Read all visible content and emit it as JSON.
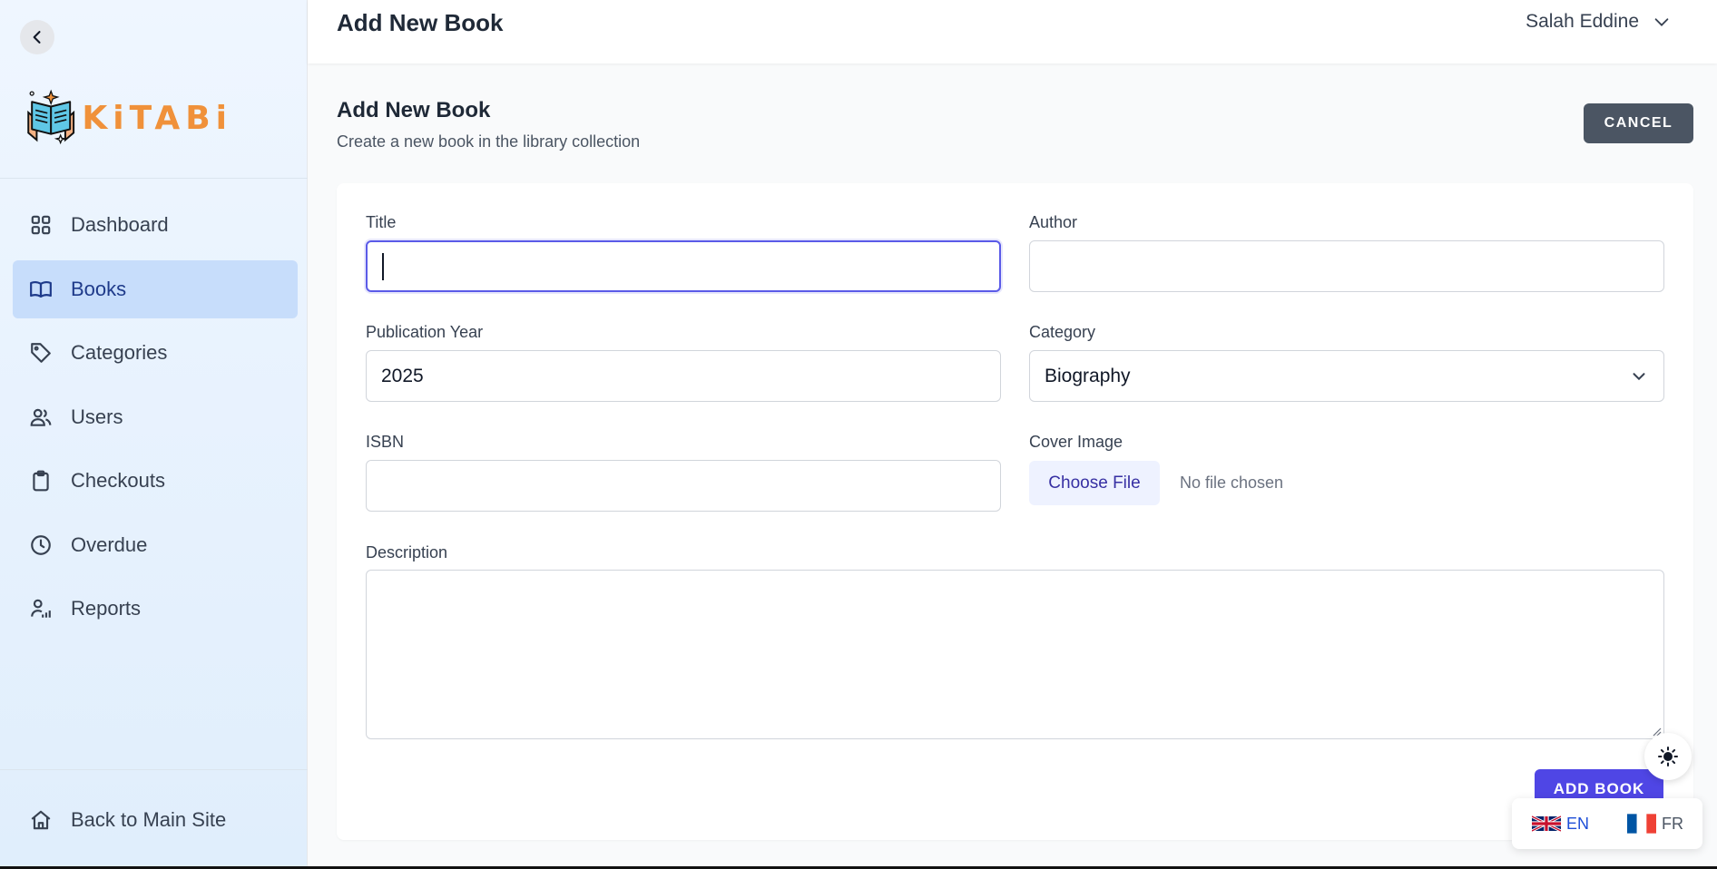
{
  "sidebar": {
    "logo_text": "KiTABi",
    "items": [
      {
        "label": "Dashboard",
        "icon": "grid-icon"
      },
      {
        "label": "Books",
        "icon": "book-open-icon",
        "active": true
      },
      {
        "label": "Categories",
        "icon": "tag-icon"
      },
      {
        "label": "Users",
        "icon": "users-icon"
      },
      {
        "label": "Checkouts",
        "icon": "clipboard-icon"
      },
      {
        "label": "Overdue",
        "icon": "clock-icon"
      },
      {
        "label": "Reports",
        "icon": "user-chart-icon"
      }
    ],
    "back_to_main": "Back to Main Site"
  },
  "header": {
    "title": "Add New Book",
    "user_name": "Salah Eddine"
  },
  "page": {
    "heading": "Add New Book",
    "subheading": "Create a new book in the library collection",
    "cancel_label": "CANCEL"
  },
  "form": {
    "title_label": "Title",
    "title_value": "",
    "author_label": "Author",
    "author_value": "",
    "year_label": "Publication Year",
    "year_value": "2025",
    "category_label": "Category",
    "category_value": "Biography",
    "isbn_label": "ISBN",
    "isbn_value": "",
    "cover_label": "Cover Image",
    "choose_file_label": "Choose File",
    "file_status": "No file chosen",
    "description_label": "Description",
    "description_value": "",
    "submit_label": "ADD BOOK"
  },
  "language": {
    "en": "EN",
    "fr": "FR",
    "selected": "EN"
  },
  "colors": {
    "accent": "#4f46e5",
    "sidebar_active": "#c7ddfb",
    "logo_orange": "#f0913a",
    "cancel_bg": "#4b5563"
  }
}
